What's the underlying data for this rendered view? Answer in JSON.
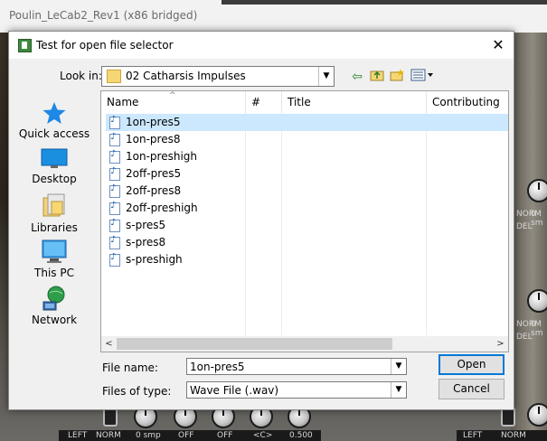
{
  "host": {
    "window_title": "Poulin_LeCab2_Rev1 (x86 bridged)"
  },
  "plugin": {
    "labels": [
      "LEFT",
      "NORM",
      "0 smp",
      "OFF",
      "OFF",
      "<C>",
      "0.500",
      "LEFT",
      "NORM"
    ],
    "right_labels": [
      "NORM",
      "0 sm",
      "DEL",
      "NORM",
      "0 sm",
      "DEL"
    ]
  },
  "dialog": {
    "title": "Test for open file selector",
    "close_glyph": "✕",
    "look_in": {
      "label": "Look in:",
      "value": "02 Catharsis Impulses"
    },
    "toolbar": {
      "back_icon": "back-arrow-icon",
      "up_icon": "up-folder-icon",
      "new_folder_icon": "new-folder-icon",
      "view_icon": "view-menu-icon"
    },
    "places": [
      {
        "label": "Quick access",
        "icon": "star-icon"
      },
      {
        "label": "Desktop",
        "icon": "desktop-icon"
      },
      {
        "label": "Libraries",
        "icon": "libraries-icon"
      },
      {
        "label": "This PC",
        "icon": "computer-icon"
      },
      {
        "label": "Network",
        "icon": "network-icon"
      }
    ],
    "columns": [
      "Name",
      "#",
      "Title",
      "Contributing art"
    ],
    "files": [
      "1on-pres5",
      "1on-pres8",
      "1on-preshigh",
      "2off-pres5",
      "2off-pres8",
      "2off-preshigh",
      "s-pres5",
      "s-pres8",
      "s-preshigh"
    ],
    "selected_index": 0,
    "file_name": {
      "label": "File name:",
      "value": "1on-pres5"
    },
    "file_type": {
      "label": "Files of type:",
      "value": "Wave File (.wav)"
    },
    "buttons": {
      "open": "Open",
      "cancel": "Cancel"
    },
    "colors": {
      "selection": "#cce8ff",
      "default_button_border": "#0078d7",
      "quick_access_star": "#1e88e5"
    }
  }
}
